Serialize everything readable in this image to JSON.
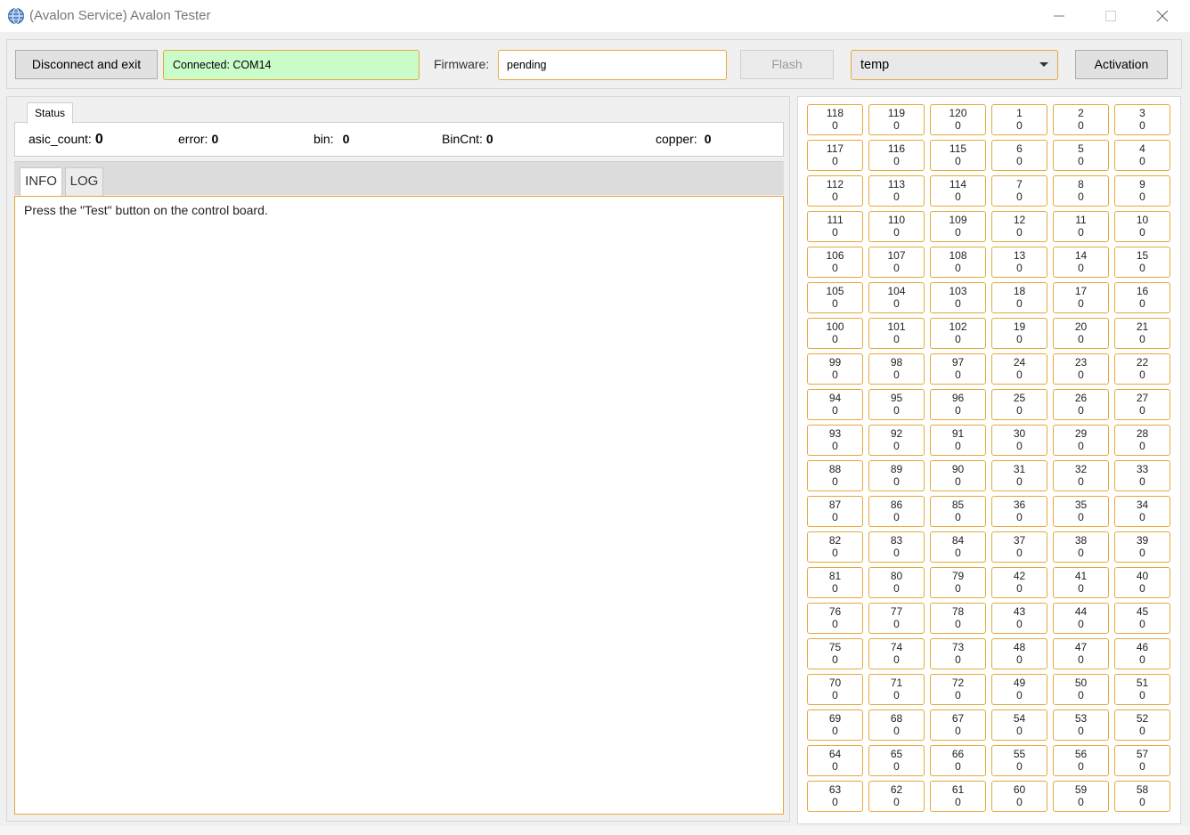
{
  "window": {
    "title": "(Avalon Service) Avalon Tester",
    "icon": "globe-icon"
  },
  "toolbar": {
    "disconnect_label": "Disconnect and exit",
    "connection_status": "Connected: COM14",
    "firmware_label": "Firmware:",
    "firmware_value": "pending",
    "flash_label": "Flash",
    "select_value": "temp",
    "activation_label": "Activation"
  },
  "status": {
    "tab_label": "Status",
    "asic_count_label": "asic_count:",
    "asic_count_value": "0",
    "error_label": "error:",
    "error_value": "0",
    "bin_label": "bin:",
    "bin_value": "0",
    "bincnt_label": "BinCnt:",
    "bincnt_value": "0",
    "copper_label": "copper:",
    "copper_value": "0"
  },
  "tabs": {
    "info": "INFO",
    "log": "LOG"
  },
  "info_text": "Press the \"Test\" button on the control board.",
  "chips": [
    [
      "118",
      "119",
      "120",
      "1",
      "2",
      "3"
    ],
    [
      "117",
      "116",
      "115",
      "6",
      "5",
      "4"
    ],
    [
      "112",
      "113",
      "114",
      "7",
      "8",
      "9"
    ],
    [
      "111",
      "110",
      "109",
      "12",
      "11",
      "10"
    ],
    [
      "106",
      "107",
      "108",
      "13",
      "14",
      "15"
    ],
    [
      "105",
      "104",
      "103",
      "18",
      "17",
      "16"
    ],
    [
      "100",
      "101",
      "102",
      "19",
      "20",
      "21"
    ],
    [
      "99",
      "98",
      "97",
      "24",
      "23",
      "22"
    ],
    [
      "94",
      "95",
      "96",
      "25",
      "26",
      "27"
    ],
    [
      "93",
      "92",
      "91",
      "30",
      "29",
      "28"
    ],
    [
      "88",
      "89",
      "90",
      "31",
      "32",
      "33"
    ],
    [
      "87",
      "86",
      "85",
      "36",
      "35",
      "34"
    ],
    [
      "82",
      "83",
      "84",
      "37",
      "38",
      "39"
    ],
    [
      "81",
      "80",
      "79",
      "42",
      "41",
      "40"
    ],
    [
      "76",
      "77",
      "78",
      "43",
      "44",
      "45"
    ],
    [
      "75",
      "74",
      "73",
      "48",
      "47",
      "46"
    ],
    [
      "70",
      "71",
      "72",
      "49",
      "50",
      "51"
    ],
    [
      "69",
      "68",
      "67",
      "54",
      "53",
      "52"
    ],
    [
      "64",
      "65",
      "66",
      "55",
      "56",
      "57"
    ],
    [
      "63",
      "62",
      "61",
      "60",
      "59",
      "58"
    ]
  ],
  "chip_value": "0",
  "colors": {
    "accent_border": "#e5a83a",
    "connected_bg": "#c9fcc9"
  }
}
